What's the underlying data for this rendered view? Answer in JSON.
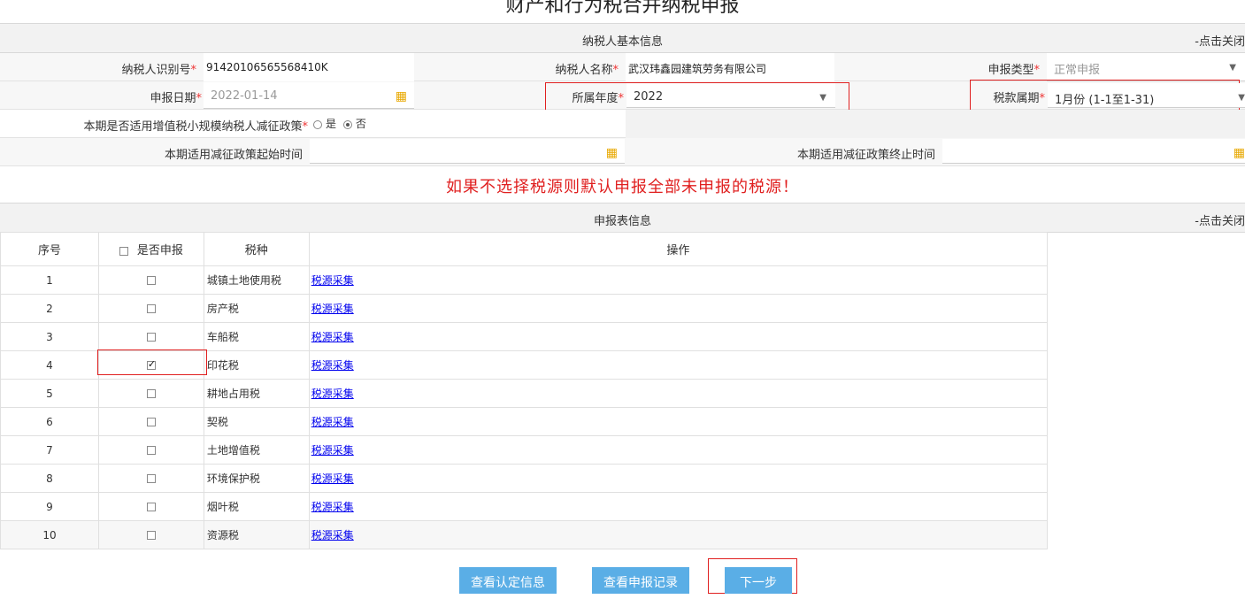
{
  "page": {
    "title": "财产和行为税合并纳税申报"
  },
  "basic_section": {
    "title": "纳税人基本信息",
    "collapse": "-点击关闭"
  },
  "form": {
    "taxpayer_id_label": "纳税人识别号",
    "taxpayer_id_value": "91420106565568410K",
    "taxpayer_name_label": "纳税人名称",
    "taxpayer_name_value": "武汉玮鑫园建筑劳务有限公司",
    "decl_type_label": "申报类型",
    "decl_type_value": "正常申报",
    "decl_date_label": "申报日期",
    "decl_date_value": "2022-01-14",
    "year_label": "所属年度",
    "year_value": "2022",
    "period_label": "税款属期",
    "period_value": "1月份 (1-1至1-31)",
    "policy_label": "本期是否适用增值税小规模纳税人减征政策",
    "policy_yes": "是",
    "policy_no": "否",
    "policy_selected": "否",
    "start_label": "本期适用减征政策起始时间",
    "end_label": "本期适用减征政策终止时间",
    "required_mark": "*"
  },
  "warning": "如果不选择税源则默认申报全部未申报的税源！",
  "decl_section": {
    "title": "申报表信息",
    "collapse": "-点击关闭"
  },
  "table": {
    "headers": [
      "序号",
      "是否申报",
      "税种",
      "操作"
    ],
    "rows": [
      {
        "no": "1",
        "tax": "城镇土地使用税",
        "action": "税源采集",
        "checked": false
      },
      {
        "no": "2",
        "tax": "房产税",
        "action": "税源采集",
        "checked": false
      },
      {
        "no": "3",
        "tax": "车船税",
        "action": "税源采集",
        "checked": false
      },
      {
        "no": "4",
        "tax": "印花税",
        "action": "税源采集",
        "checked": true
      },
      {
        "no": "5",
        "tax": "耕地占用税",
        "action": "税源采集",
        "checked": false
      },
      {
        "no": "6",
        "tax": "契税",
        "action": "税源采集",
        "checked": false
      },
      {
        "no": "7",
        "tax": "土地增值税",
        "action": "税源采集",
        "checked": false
      },
      {
        "no": "8",
        "tax": "环境保护税",
        "action": "税源采集",
        "checked": false
      },
      {
        "no": "9",
        "tax": "烟叶税",
        "action": "税源采集",
        "checked": false
      },
      {
        "no": "10",
        "tax": "资源税",
        "action": "税源采集",
        "checked": false
      }
    ]
  },
  "buttons": {
    "view_cert": "查看认定信息",
    "view_records": "查看申报记录",
    "next": "下一步"
  },
  "icons": {
    "calendar": "calendar-icon",
    "dropdown": "caret-down-icon"
  },
  "colors": {
    "button": "#5aaee6",
    "warning": "#e02020",
    "highlight_box": "#e02020",
    "calendar": "#e8a800",
    "link": "#0000ee"
  }
}
